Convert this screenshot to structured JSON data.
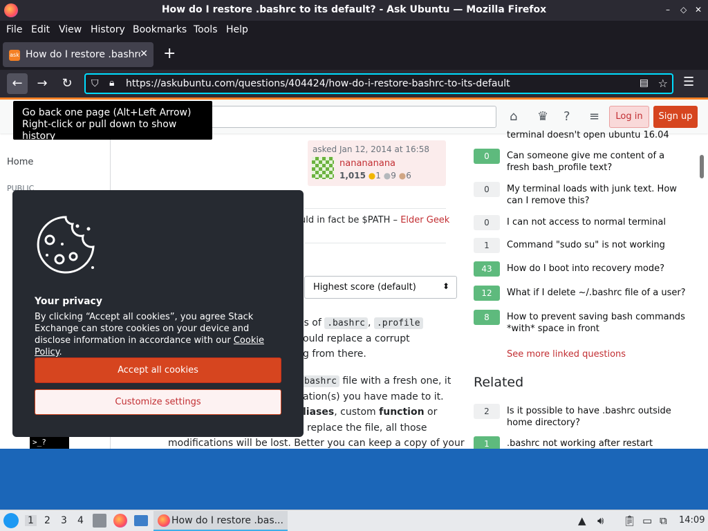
{
  "window": {
    "title": "How do I restore .bashrc to its default? - Ask Ubuntu — Mozilla Firefox",
    "buttons": {
      "minimize": "–",
      "maximize": "◇",
      "close": "✕"
    }
  },
  "menu": [
    "File",
    "Edit",
    "View",
    "History",
    "Bookmarks",
    "Tools",
    "Help"
  ],
  "tab": {
    "favicon_text": "ask",
    "label": "How do I restore .bashrc",
    "close": "✕",
    "new_tab": "+"
  },
  "nav": {
    "back": "←",
    "forward": "→",
    "reload": "↻",
    "url": "https://askubuntu.com/questions/404424/how-do-i-restore-bashrc-to-its-default",
    "menu": "☰"
  },
  "tooltip": {
    "line1": "Go back one page (Alt+Left Arrow)",
    "line2": "Right-click or pull down to show history"
  },
  "header": {
    "login": "Log in",
    "signup": "Sign up"
  },
  "leftnav": {
    "home": "Home",
    "public": "PUBLIC"
  },
  "asked": {
    "text": "asked Jan 12, 2014 at 16:58",
    "user": "nanananana",
    "reputation": "1,015",
    "gold": "1",
    "silver": "9",
    "bronze": "6"
  },
  "comment": {
    "text": "uld in fact be $PATH –",
    "author": "Elder Geek"
  },
  "sort": {
    "selected": "Highest score (default)"
  },
  "answer": {
    "l1a": "ies of",
    "c1": ".bashrc",
    "l1b": ",",
    "c2": ".profile",
    "l2": "ould replace a corrupt",
    "l3": "g from there.",
    "c3": "bashrc",
    "l4": "file with a fresh one, it",
    "l5": "ation(s) you have made to it.",
    "l6a": "liases",
    "l6b": ", custom",
    "l6c": "function",
    "l6d": "or",
    "l7": "replace the file, all those",
    "l8": "modifications will be lost. Better you can keep a copy of your"
  },
  "linked": [
    {
      "score": "",
      "text": "terminal doesn't open ubuntu 16.04",
      "green": false
    },
    {
      "score": "0",
      "text": "Can someone give me content of a fresh bash_profile text?",
      "green": true
    },
    {
      "score": "0",
      "text": "My terminal loads with junk text. How can I remove this?",
      "green": false
    },
    {
      "score": "0",
      "text": "I can not access to normal terminal",
      "green": false
    },
    {
      "score": "1",
      "text": "Command \"sudo su\" is not working",
      "green": false
    },
    {
      "score": "43",
      "text": "How do I boot into recovery mode?",
      "green": true
    },
    {
      "score": "12",
      "text": "What if I delete ~/.bashrc file of a user?",
      "green": true
    },
    {
      "score": "8",
      "text": "How to prevent saving bash commands *with* space in front",
      "green": true
    }
  ],
  "see_more": "See more linked questions",
  "related_title": "Related",
  "related": [
    {
      "score": "2",
      "text": "Is it possible to have .bashrc outside home directory?",
      "green": false
    },
    {
      "score": "1",
      "text": ".bashrc not working after restart",
      "green": true
    }
  ],
  "cookie": {
    "title": "Your privacy",
    "text": "By clicking “Accept all cookies”, you agree Stack Exchange can store cookies on your device and disclose information in accordance with our",
    "policy": "Cookie Policy",
    "period": ".",
    "accept": "Accept all cookies",
    "customize": "Customize settings"
  },
  "terminal": ">_?",
  "taskbar": {
    "workspaces": [
      "1",
      "2",
      "3",
      "4"
    ],
    "app_label": "How do I restore .bas...",
    "clock": "14:09"
  },
  "colors": {
    "accent": "#f48024",
    "signup": "#d6451f",
    "link": "#c22e32",
    "score_green": "#5eba7d"
  }
}
